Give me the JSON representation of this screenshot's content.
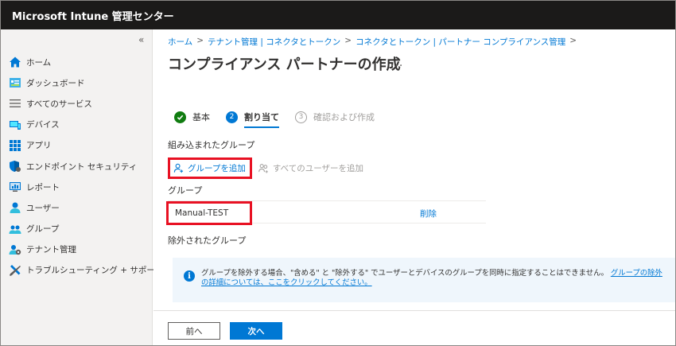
{
  "app": {
    "title": "Microsoft Intune 管理センター"
  },
  "sidebar": {
    "collapse_glyph": "«",
    "items": [
      {
        "label": "ホーム",
        "icon": "home-icon"
      },
      {
        "label": "ダッシュボード",
        "icon": "dashboard-icon"
      },
      {
        "label": "すべてのサービス",
        "icon": "list-icon"
      },
      {
        "label": "デバイス",
        "icon": "devices-icon"
      },
      {
        "label": "アプリ",
        "icon": "apps-icon"
      },
      {
        "label": "エンドポイント セキュリティ",
        "icon": "endpoint-security-icon"
      },
      {
        "label": "レポート",
        "icon": "reports-icon"
      },
      {
        "label": "ユーザー",
        "icon": "user-icon"
      },
      {
        "label": "グループ",
        "icon": "groups-icon"
      },
      {
        "label": "テナント管理",
        "icon": "tenant-admin-icon"
      },
      {
        "label": "トラブルシューティング + サポート",
        "icon": "troubleshooting-icon"
      }
    ]
  },
  "breadcrumb": [
    "ホーム",
    "テナント管理 | コネクタとトークン",
    "コネクタとトークン | パートナー コンプライアンス管理"
  ],
  "breadcrumb_separator": ">",
  "page": {
    "title": "コンプライアンス パートナーの作成",
    "more": "..."
  },
  "steps": [
    {
      "label": "基本",
      "state": "done"
    },
    {
      "label": "割り当て",
      "state": "active",
      "number": "2"
    },
    {
      "label": "確認および作成",
      "state": "pending",
      "number": "3"
    }
  ],
  "included": {
    "label": "組み込まれたグループ",
    "add_group": "グループを追加",
    "add_all_users": "すべてのユーザーを追加",
    "column_header": "グループ",
    "rows": [
      {
        "name": "Manual-TEST",
        "action": "削除"
      }
    ]
  },
  "excluded": {
    "label": "除外されたグループ"
  },
  "info": {
    "icon": "info-icon",
    "text": "グループを除外する場合、\"含める\" と \"除外する\" でユーザーとデバイスのグループを同時に指定することはできません。",
    "link": "グループの除外の詳細については、ここをクリックしてください。"
  },
  "footer": {
    "prev": "前へ",
    "next": "次へ"
  },
  "colors": {
    "header_bg": "#1b1a19",
    "accent": "#0078d4",
    "success": "#107c10",
    "highlight": "#e81123",
    "sidebar_bg": "#f3f2f1",
    "info_bg": "#eff6fc"
  }
}
